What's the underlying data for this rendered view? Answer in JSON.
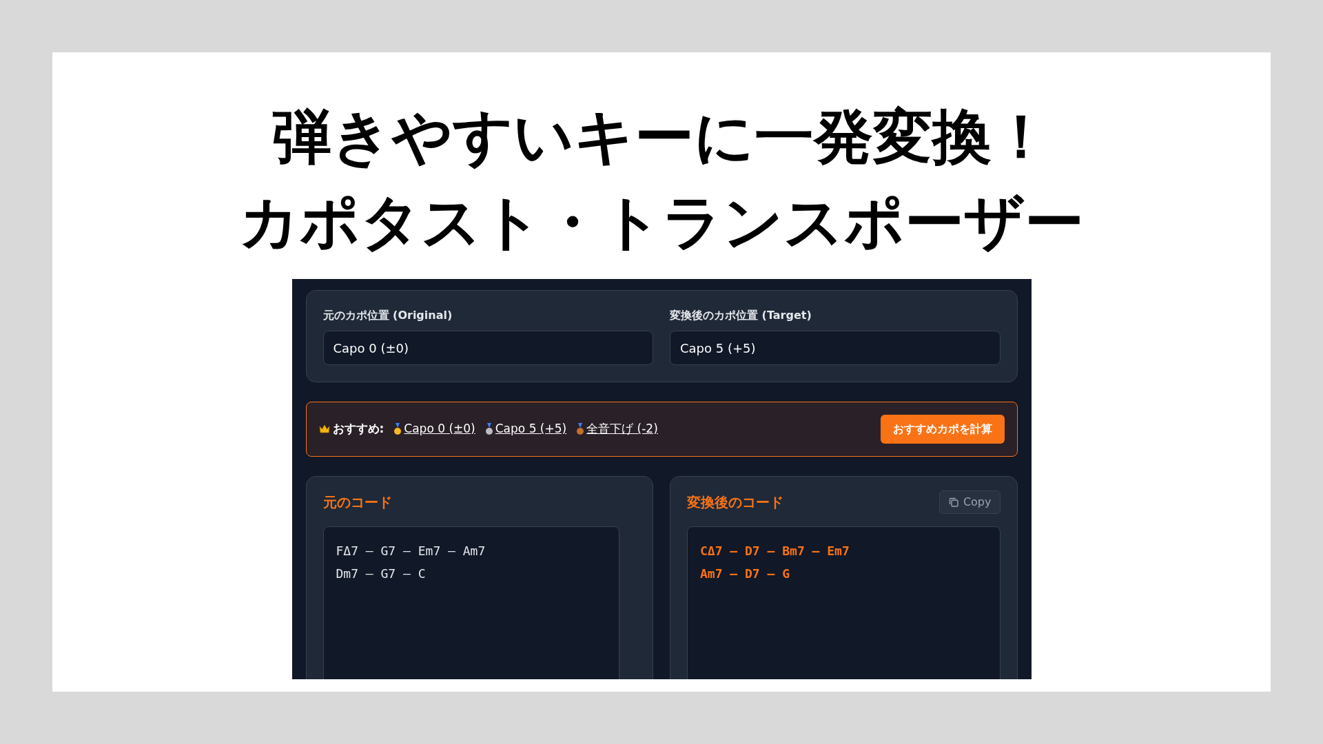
{
  "headline": [
    "弾きやすいキーに一発変換！",
    "カポタスト・トランスポーザー"
  ],
  "capo_settings": [
    {
      "label": "元のカポ位置 (Original)",
      "value": "Capo 0 (±0)"
    },
    {
      "label": "変換後のカポ位置 (Target)",
      "value": "Capo 5 (+5)"
    }
  ],
  "recommendation": {
    "label": "おすすめ:",
    "options": [
      {
        "kind": "gold",
        "text": "Capo 0 (±0)"
      },
      {
        "kind": "silver",
        "text": "Capo 5 (+5)"
      },
      {
        "kind": "bronze",
        "text": "全音下げ (-2)"
      }
    ],
    "button": "おすすめカポを計算"
  },
  "chord_panels": [
    {
      "title": "元のコード",
      "kind": "original",
      "lines": [
        "FΔ7 — G7 — Em7 — Am7",
        "Dm7 — G7 — C"
      ]
    },
    {
      "title": "変換後のコード",
      "kind": "converted",
      "copy_button": "Copy",
      "lines": [
        "CΔ7 — D7 — Bm7 — Em7",
        "Am7 — D7 — G"
      ]
    }
  ]
}
